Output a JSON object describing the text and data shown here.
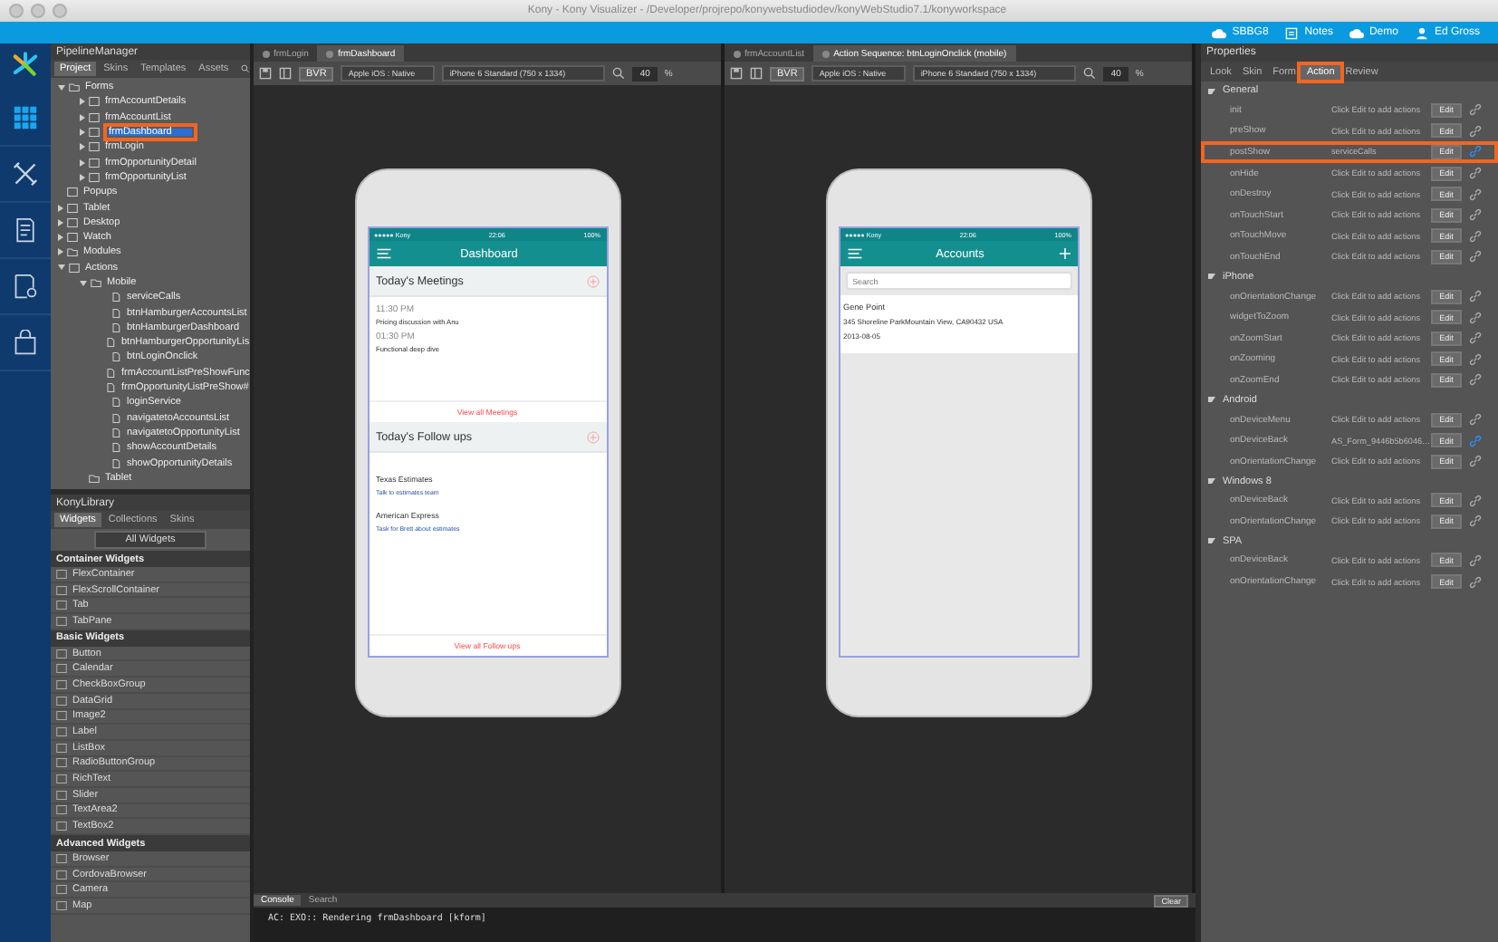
{
  "window": {
    "title": "Kony - Kony Visualizer - /Developer/projrepo/konywebstudiodev/konyWebStudio7.1/konyworkspace"
  },
  "account_bar": [
    {
      "kind": "cloud",
      "label": "SBBG8"
    },
    {
      "kind": "notes",
      "label": "Notes"
    },
    {
      "kind": "cloud",
      "label": "Demo"
    },
    {
      "kind": "user",
      "label": "Ed Gross"
    }
  ],
  "rail": [
    {
      "kind": "grid",
      "selected": true
    },
    {
      "kind": "tools",
      "selected": false
    },
    {
      "kind": "doc",
      "selected": false
    },
    {
      "kind": "service",
      "selected": false
    },
    {
      "kind": "bag",
      "selected": false
    }
  ],
  "project": {
    "title": "PipelineManager",
    "tabs": [
      {
        "label": "Project",
        "selected": true
      },
      {
        "label": "Skins",
        "selected": false
      },
      {
        "label": "Templates",
        "selected": false
      },
      {
        "label": "Assets",
        "selected": false
      }
    ],
    "tree": [
      {
        "label": "Forms",
        "kind": "folder",
        "expanded": true,
        "selected": false,
        "children": [
          {
            "label": "frmAccountDetails",
            "kind": "form",
            "expanded": false,
            "selected": false
          },
          {
            "label": "frmAccountList",
            "kind": "form",
            "expanded": false,
            "selected": false
          },
          {
            "label": "frmDashboard",
            "kind": "form",
            "expanded": false,
            "selected": true,
            "highlighted": true
          },
          {
            "label": "frmLogin",
            "kind": "form",
            "expanded": false,
            "selected": false
          },
          {
            "label": "frmOpportunityDetail",
            "kind": "form",
            "expanded": false,
            "selected": false
          },
          {
            "label": "frmOpportunityList",
            "kind": "form",
            "expanded": false,
            "selected": false
          }
        ]
      },
      {
        "label": "Popups",
        "kind": "popup",
        "selected": false
      },
      {
        "label": "Tablet",
        "kind": "device",
        "expanded": false,
        "selected": false
      },
      {
        "label": "Desktop",
        "kind": "device",
        "expanded": false,
        "selected": false
      },
      {
        "label": "Watch",
        "kind": "device",
        "expanded": false,
        "selected": false
      },
      {
        "label": "Modules",
        "kind": "folder",
        "expanded": false,
        "selected": false
      },
      {
        "label": "Actions",
        "kind": "device",
        "expanded": true,
        "selected": false,
        "children": [
          {
            "label": "Mobile",
            "kind": "folder",
            "expanded": true,
            "selected": false,
            "children": [
              {
                "label": "serviceCalls",
                "kind": "file",
                "selected": false
              },
              {
                "label": "btnHamburgerAccountsList",
                "kind": "file",
                "selected": false
              },
              {
                "label": "btnHamburgerDashboard",
                "kind": "file",
                "selected": false
              },
              {
                "label": "btnHamburgerOpportunityLis",
                "kind": "file",
                "selected": false
              },
              {
                "label": "btnLoginOnclick",
                "kind": "file",
                "selected": false
              },
              {
                "label": "frmAccountListPreShowFunc",
                "kind": "file",
                "selected": false
              },
              {
                "label": "frmOpportunityListPreShow#",
                "kind": "file",
                "selected": false
              },
              {
                "label": "loginService",
                "kind": "file",
                "selected": false
              },
              {
                "label": "navigatetoAccountsList",
                "kind": "file",
                "selected": false
              },
              {
                "label": "navigatetoOpportunityList",
                "kind": "file",
                "selected": false
              },
              {
                "label": "showAccountDetails",
                "kind": "file",
                "selected": false
              },
              {
                "label": "showOpportunityDetails",
                "kind": "file",
                "selected": false
              }
            ]
          },
          {
            "label": "Tablet",
            "kind": "folder",
            "selected": false
          }
        ]
      }
    ]
  },
  "library": {
    "title": "KonyLibrary",
    "tabs": [
      {
        "label": "Widgets",
        "selected": true
      },
      {
        "label": "Collections",
        "selected": false
      },
      {
        "label": "Skins",
        "selected": false
      }
    ],
    "filter": "All Widgets",
    "groups": [
      {
        "title": "Container Widgets",
        "items": [
          "FlexContainer",
          "FlexScrollContainer",
          "Tab",
          "TabPane"
        ]
      },
      {
        "title": "Basic Widgets",
        "items": [
          "Button",
          "Calendar",
          "CheckBoxGroup",
          "DataGrid",
          "Image2",
          "Label",
          "ListBox",
          "RadioButtonGroup",
          "RichText",
          "Slider",
          "TextArea2",
          "TextBox2"
        ]
      },
      {
        "title": "Advanced Widgets",
        "items": [
          "Browser",
          "CordovaBrowser",
          "Camera",
          "Map"
        ]
      }
    ]
  },
  "editors": [
    {
      "tabs": [
        {
          "label": "frmLogin",
          "selected": false
        },
        {
          "label": "frmDashboard",
          "selected": true
        }
      ],
      "toolbar": {
        "mode": "BVR",
        "platform": "Apple iOS : Native",
        "device": "iPhone 6 Standard (750 x 1334)",
        "zoom": "40",
        "unit": "%"
      },
      "phone": {
        "kind": "dashboard",
        "carrier": "●●●●● Kony",
        "time": "22:06",
        "battery": "100%",
        "title": "Dashboard",
        "sections": [
          {
            "title": "Today's Meetings",
            "items": [
              {
                "kind": "meeting",
                "time": "11:30 PM",
                "text": "Pricing discussion with Anu"
              },
              {
                "kind": "meeting",
                "time": "01:30 PM",
                "text": "Functional deep dive"
              }
            ],
            "link": "View all Meetings"
          },
          {
            "title": "Today's Follow ups",
            "items": [
              {
                "kind": "followup",
                "time": "Texas Estimates",
                "text": "Talk to estimates team"
              },
              {
                "kind": "followup",
                "time": "American Express",
                "text": "Task for Brett about estimates"
              }
            ],
            "link": "View all Follow ups"
          }
        ]
      }
    },
    {
      "tabs": [
        {
          "label": "frmAccountList",
          "selected": false
        },
        {
          "label": "Action Sequence: btnLoginOnclick (mobile)",
          "selected": true
        }
      ],
      "toolbar": {
        "mode": "BVR",
        "platform": "Apple iOS : Native",
        "device": "iPhone 6 Standard (750 x 1334)",
        "zoom": "40",
        "unit": "%"
      },
      "phone": {
        "kind": "accounts",
        "carrier": "●●●●● Kony",
        "time": "22:06",
        "battery": "100%",
        "title": "Accounts",
        "search_placeholder": "Search",
        "account": [
          "Gene Point",
          "345 Shoreline ParkMountain View, CA90432 USA",
          "2013-08-05"
        ]
      }
    }
  ],
  "console": {
    "tabs": [
      {
        "label": "Console",
        "selected": true
      },
      {
        "label": "Search",
        "selected": false
      }
    ],
    "clear": "Clear",
    "line": "AC: EXO:: Rendering frmDashboard [kform]"
  },
  "properties": {
    "title": "Properties",
    "tabs": [
      {
        "label": "Look",
        "selected": false
      },
      {
        "label": "Skin",
        "selected": false
      },
      {
        "label": "Form",
        "selected": false
      },
      {
        "label": "Action",
        "selected": true,
        "highlighted": true
      },
      {
        "label": "Review",
        "selected": false
      }
    ],
    "sections": [
      {
        "title": "General",
        "expanded": true,
        "events": [
          {
            "name": "init",
            "value": "Click Edit to add actions",
            "edit": "Edit",
            "linked": false
          },
          {
            "name": "preShow",
            "value": "Click Edit to add actions",
            "edit": "Edit",
            "linked": false
          },
          {
            "name": "postShow",
            "value": "serviceCalls",
            "edit": "Edit",
            "linked": true,
            "highlighted": true
          },
          {
            "name": "onHide",
            "value": "Click Edit to add actions",
            "edit": "Edit",
            "linked": false
          },
          {
            "name": "onDestroy",
            "value": "Click Edit to add actions",
            "edit": "Edit",
            "linked": false
          },
          {
            "name": "onTouchStart",
            "value": "Click Edit to add actions",
            "edit": "Edit",
            "linked": false
          },
          {
            "name": "onTouchMove",
            "value": "Click Edit to add actions",
            "edit": "Edit",
            "linked": false
          },
          {
            "name": "onTouchEnd",
            "value": "Click Edit to add actions",
            "edit": "Edit",
            "linked": false
          }
        ]
      },
      {
        "title": "iPhone",
        "expanded": true,
        "events": [
          {
            "name": "onOrientationChange",
            "value": "Click Edit to add actions",
            "edit": "Edit",
            "linked": false
          },
          {
            "name": "widgetToZoom",
            "value": "Click Edit to add actions",
            "edit": "Edit",
            "linked": false
          },
          {
            "name": "onZoomStart",
            "value": "Click Edit to add actions",
            "edit": "Edit",
            "linked": false
          },
          {
            "name": "onZooming",
            "value": "Click Edit to add actions",
            "edit": "Edit",
            "linked": false
          },
          {
            "name": "onZoomEnd",
            "value": "Click Edit to add actions",
            "edit": "Edit",
            "linked": false
          }
        ]
      },
      {
        "title": "Android",
        "expanded": true,
        "events": [
          {
            "name": "onDeviceMenu",
            "value": "Click Edit to add actions",
            "edit": "Edit",
            "linked": false
          },
          {
            "name": "onDeviceBack",
            "value": "AS_Form_9446b5b6046…",
            "edit": "Edit",
            "linked": true
          },
          {
            "name": "onOrientationChange",
            "value": "Click Edit to add actions",
            "edit": "Edit",
            "linked": false
          }
        ]
      },
      {
        "title": "Windows 8",
        "expanded": true,
        "events": [
          {
            "name": "onDeviceBack",
            "value": "Click Edit to add actions",
            "edit": "Edit",
            "linked": false
          },
          {
            "name": "onOrientationChange",
            "value": "Click Edit to add actions",
            "edit": "Edit",
            "linked": false
          }
        ]
      },
      {
        "title": "SPA",
        "expanded": true,
        "events": [
          {
            "name": "onDeviceBack",
            "value": "Click Edit to add actions",
            "edit": "Edit",
            "linked": false
          },
          {
            "name": "onOrientationChange",
            "value": "Click Edit to add actions",
            "edit": "Edit",
            "linked": false
          }
        ]
      }
    ]
  }
}
